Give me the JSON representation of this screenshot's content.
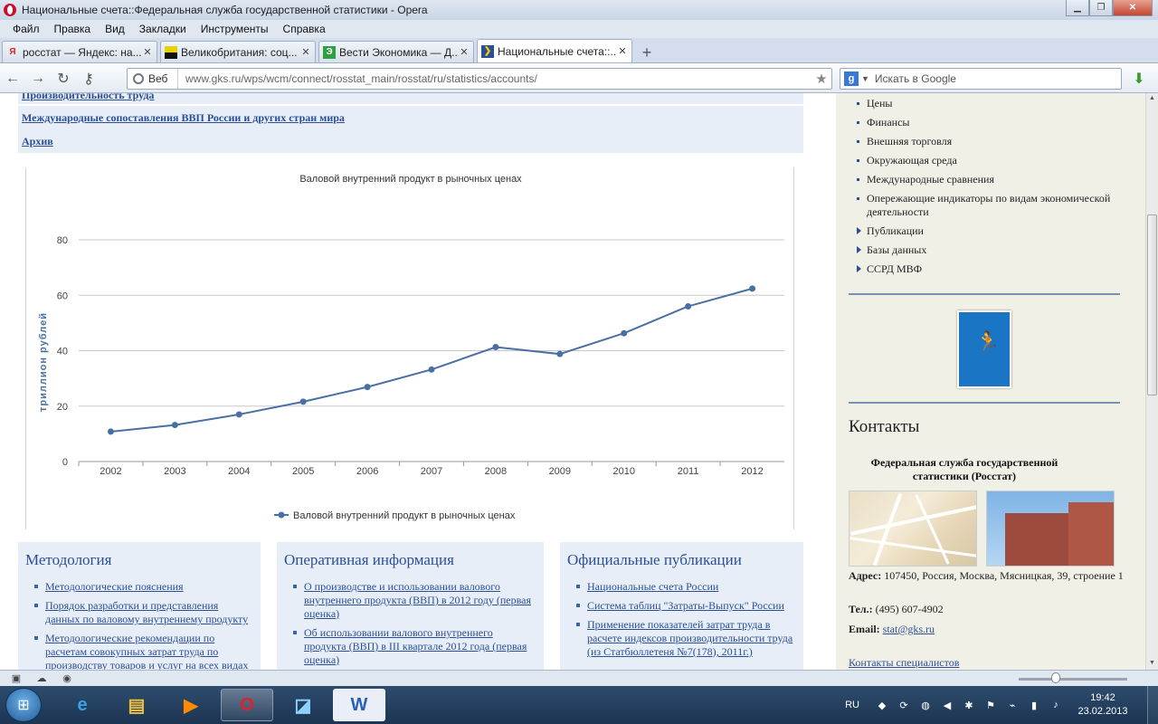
{
  "window": {
    "title": "Национальные счета::Федеральная служба государственной статистики - Opera",
    "controls": {
      "minimize": "▁",
      "maximize": "❐",
      "close": "✕"
    }
  },
  "menu": [
    "Файл",
    "Правка",
    "Вид",
    "Закладки",
    "Инструменты",
    "Справка"
  ],
  "tabs": [
    {
      "label": "росстат — Яндекс: на...",
      "icon": "Я",
      "icon_color": "#d8261e",
      "active": false
    },
    {
      "label": "Великобритания: соц...",
      "icon": "",
      "icon_color": "#e8d300",
      "active": false
    },
    {
      "label": "Вести Экономика — Д...",
      "icon": "Э",
      "icon_color": "#2ea043",
      "active": false
    },
    {
      "label": "Национальные счета::...",
      "icon": "❯",
      "icon_color": "#2b4f95",
      "active": true
    }
  ],
  "newtab_label": "+",
  "address": {
    "web_label": "Веб",
    "url": "www.gks.ru/wps/wcm/connect/rosstat_main/rosstat/ru/statistics/accounts/",
    "search_placeholder": "Искать в Google"
  },
  "content": {
    "link_rows": [
      "Производительность труда",
      "Международные сопоставления ВВП России и других стран мира",
      "Архив"
    ],
    "panels": [
      {
        "title": "Методология",
        "items": [
          "Методологические пояснения",
          "Порядок разработки и представления данных по валовому внутреннему продукту",
          "Методологические рекомендации по расчетам совокупных затрат труда по производству товаров и услуг на всех видах"
        ]
      },
      {
        "title": "Оперативная информация",
        "items": [
          "О производстве и использовании валового внутреннего продукта (ВВП) в 2012 году (первая оценка)",
          "Об использовании валового внутреннего продукта (ВВП) в III квартале 2012 года (первая оценка)"
        ]
      },
      {
        "title": "Официальные публикации",
        "items": [
          "Национальные счета России",
          "Система таблиц \"Затраты-Выпуск\" России",
          "Применение показателей затрат труда в расчете индексов производительности труда (из Статбюллетеня №7(178), 2011г.)"
        ]
      }
    ]
  },
  "chart_data": {
    "type": "line",
    "title": "Валовой внутренний продукт в рыночных ценах",
    "xlabel": "",
    "ylabel": "триллион рублей",
    "categories": [
      "2002",
      "2003",
      "2004",
      "2005",
      "2006",
      "2007",
      "2008",
      "2009",
      "2010",
      "2011",
      "2012"
    ],
    "series": [
      {
        "name": "Валовой внутренний продукт в рыночных ценах",
        "values": [
          10.8,
          13.2,
          17.0,
          21.6,
          26.9,
          33.2,
          41.3,
          38.8,
          46.3,
          56.0,
          62.4
        ],
        "color": "#4a6fa5"
      }
    ],
    "yticks": [
      "0",
      "20",
      "40",
      "60",
      "80"
    ],
    "ylim": [
      0,
      80
    ],
    "grid": true,
    "legend": "bottom"
  },
  "sidebar": {
    "menu_items": [
      {
        "label": "Цены",
        "marker": "bullet"
      },
      {
        "label": "Финансы",
        "marker": "bullet"
      },
      {
        "label": "Внешняя торговля",
        "marker": "bullet"
      },
      {
        "label": "Окружающая среда",
        "marker": "bullet"
      },
      {
        "label": "Международные сравнения",
        "marker": "bullet"
      },
      {
        "label": "Опережающие индикаторы по видам экономической деятельности",
        "marker": "bullet"
      },
      {
        "label": "Публикации",
        "marker": "triangle"
      },
      {
        "label": "Базы данных",
        "marker": "triangle"
      },
      {
        "label": "ССРД МВФ",
        "marker": "triangle"
      }
    ],
    "contacts_title": "Контакты",
    "org_name": "Федеральная служба государственной статистики (Росстат)",
    "address_label": "Адрес:",
    "address_value": " 107450, Россия, Москва, Мясницкая, 39, строение 1",
    "phone_label": "Тел.:",
    "phone_value": " (495) 607-4902",
    "email_label": "Email:",
    "email_value": "stat@gks.ru",
    "specialists_link": "Контакты специалистов"
  },
  "taskbar": {
    "lang": "RU",
    "time": "19:42",
    "date": "23.02.2013"
  }
}
